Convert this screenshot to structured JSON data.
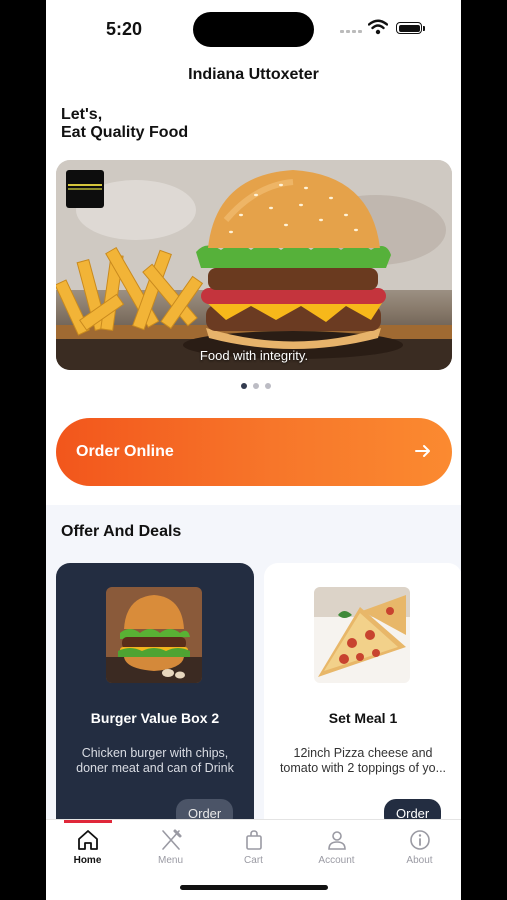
{
  "status": {
    "time": "5:20"
  },
  "header": {
    "store_name": "Indiana Uttoxeter"
  },
  "greeting": {
    "line1": "Let's,",
    "line2": "Eat Quality Food"
  },
  "hero": {
    "caption": "Food with integrity.",
    "slides": 3,
    "active_slide": 1
  },
  "cta": {
    "label": "Order Online"
  },
  "offers": {
    "title": "Offer And Deals",
    "items": [
      {
        "title": "Burger Value Box 2",
        "desc_line1": "Chicken burger with chips,",
        "desc_line2": "doner meat and can of Drink",
        "button": "Order"
      },
      {
        "title": "Set Meal 1",
        "desc_line1": "12inch Pizza cheese and",
        "desc_line2": "tomato with 2 toppings of yo...",
        "button": "Order"
      }
    ]
  },
  "tabs": [
    {
      "label": "Home",
      "icon": "home-icon"
    },
    {
      "label": "Menu",
      "icon": "utensils-icon"
    },
    {
      "label": "Cart",
      "icon": "bag-icon"
    },
    {
      "label": "Account",
      "icon": "user-icon"
    },
    {
      "label": "About",
      "icon": "info-icon"
    }
  ],
  "colors": {
    "accent_start": "#f2561c",
    "accent_end": "#fb8a30",
    "dark_card": "#232d41",
    "tab_active": "#e0283a"
  }
}
